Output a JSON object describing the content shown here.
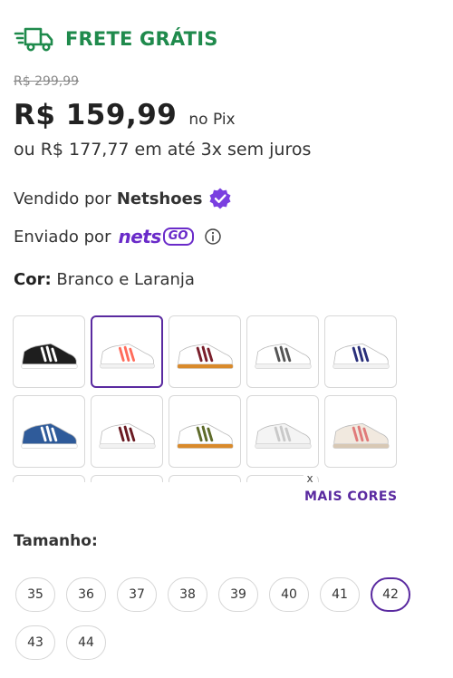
{
  "shipping": {
    "icon": "delivery-truck-icon",
    "label": "FRETE GRÁTIS",
    "color": "#1f8a4c"
  },
  "pricing": {
    "old_price": "R$ 299,99",
    "price": "R$ 159,99",
    "price_note": "no Pix",
    "installments": "ou R$ 177,77 em até 3x sem juros"
  },
  "seller": {
    "prefix": "Vendido por",
    "name": "Netshoes",
    "badge_icon": "verified-badge-icon"
  },
  "shipper": {
    "prefix": "Enviado por",
    "logo_main": "nets",
    "logo_badge": "GO",
    "info_icon": "info-icon"
  },
  "color": {
    "label": "Cor:",
    "value": "Branco e Laranja"
  },
  "swatches": [
    {
      "name": "black-white-stripes",
      "body": "#1e1e1e",
      "stripe": "#ffffff",
      "sole": "#ffffff",
      "selected": false
    },
    {
      "name": "white-orange-stripes",
      "body": "#ffffff",
      "stripe": "#ff6b5a",
      "sole": "#f2f2f2",
      "selected": true
    },
    {
      "name": "white-burgundy-gum",
      "body": "#ffffff",
      "stripe": "#7a1f2b",
      "sole": "#d98a2b",
      "selected": false
    },
    {
      "name": "white-grey-stripes",
      "body": "#ffffff",
      "stripe": "#555555",
      "sole": "#f2f2f2",
      "selected": false
    },
    {
      "name": "white-navy-stripes",
      "body": "#ffffff",
      "stripe": "#2a2f7a",
      "sole": "#f2f2f2",
      "selected": false
    },
    {
      "name": "blue-white-stripes",
      "body": "#2f5b9a",
      "stripe": "#ffffff",
      "sole": "#ffffff",
      "selected": false
    },
    {
      "name": "white-maroon-red",
      "body": "#ffffff",
      "stripe": "#6a1a22",
      "sole": "#f2f2f2",
      "selected": false
    },
    {
      "name": "white-olive-gum",
      "body": "#ffffff",
      "stripe": "#5e6b2a",
      "sole": "#d98a2b",
      "selected": false
    },
    {
      "name": "white-silver-stripes",
      "body": "#f4f4f4",
      "stripe": "#c9c9c9",
      "sole": "#eeeeee",
      "selected": false
    },
    {
      "name": "cream-pink-beige",
      "body": "#f1e9df",
      "stripe": "#e07a7a",
      "sole": "#d8c8b4",
      "selected": false
    },
    {
      "name": "partial-1",
      "body": "#ffffff",
      "stripe": "#dddddd",
      "sole": "#f2f2f2",
      "selected": false
    },
    {
      "name": "partial-2",
      "body": "#ffffff",
      "stripe": "#dddddd",
      "sole": "#f2f2f2",
      "selected": false
    },
    {
      "name": "partial-3",
      "body": "#ffffff",
      "stripe": "#dddddd",
      "sole": "#f2f2f2",
      "selected": false
    },
    {
      "name": "partial-4",
      "body": "#ffffff",
      "stripe": "#dddddd",
      "sole": "#f2f2f2",
      "selected": false
    }
  ],
  "more_colors": {
    "close_icon": "close-icon",
    "close_glyph": "x",
    "label": "MAIS CORES"
  },
  "size": {
    "label": "Tamanho:",
    "options": [
      "35",
      "36",
      "37",
      "38",
      "39",
      "40",
      "41",
      "42",
      "43",
      "44"
    ],
    "selected": "42"
  },
  "colors": {
    "accent": "#5a2aa0",
    "netsgo": "#6a2bc9",
    "free_shipping": "#1f8a4c"
  }
}
